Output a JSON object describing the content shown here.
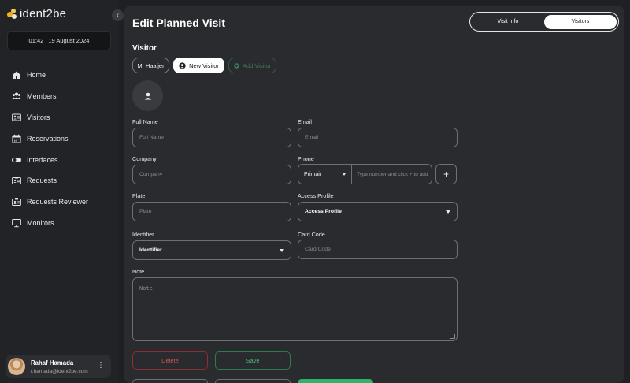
{
  "app": {
    "logo_text": "ident2be"
  },
  "sidebar": {
    "time": "01:42",
    "date": "19 August 2024",
    "items": [
      {
        "label": "Home",
        "icon": "home-icon"
      },
      {
        "label": "Members",
        "icon": "members-icon"
      },
      {
        "label": "Visitors",
        "icon": "visitors-icon"
      },
      {
        "label": "Reservations",
        "icon": "calendar-icon"
      },
      {
        "label": "Interfaces",
        "icon": "toggle-icon"
      },
      {
        "label": "Requests",
        "icon": "requests-icon"
      },
      {
        "label": "Requests Reviewer",
        "icon": "requests-reviewer-icon"
      },
      {
        "label": "Monitors",
        "icon": "monitor-icon"
      }
    ],
    "user": {
      "name": "Rahaf Hamada",
      "email": "r.hamada@ident2be.com"
    }
  },
  "header": {
    "title": "Edit Planned Visit",
    "tabs": [
      {
        "label": "Visit Info",
        "active": false
      },
      {
        "label": "Visitors",
        "active": true
      }
    ]
  },
  "visitor": {
    "section_title": "Visitor",
    "chips": {
      "existing": "M. Haaijer",
      "new": "New Visitor",
      "add": "Add Visitor"
    }
  },
  "form": {
    "full_name": {
      "label": "Full Name",
      "placeholder": "Full Name"
    },
    "email": {
      "label": "Email",
      "placeholder": "Email"
    },
    "company": {
      "label": "Company",
      "placeholder": "Company"
    },
    "phone": {
      "label": "Phone",
      "type": "Primair",
      "placeholder": "Type number and click + to add"
    },
    "plate": {
      "label": "Plate",
      "placeholder": "Plate"
    },
    "access_profile": {
      "label": "Access Profile",
      "value": "Access Profile"
    },
    "identifier": {
      "label": "Identifier",
      "value": "Identifier"
    },
    "card_code": {
      "label": "Card Code",
      "placeholder": "Card Code"
    },
    "note": {
      "label": "Note",
      "placeholder": "Note"
    }
  },
  "actions": {
    "delete": "Delete",
    "save": "Save"
  },
  "colors": {
    "accent_green": "#2fb36a",
    "danger": "#d9534f",
    "panel": "#2a2b2f",
    "sidebar": "#222326"
  }
}
